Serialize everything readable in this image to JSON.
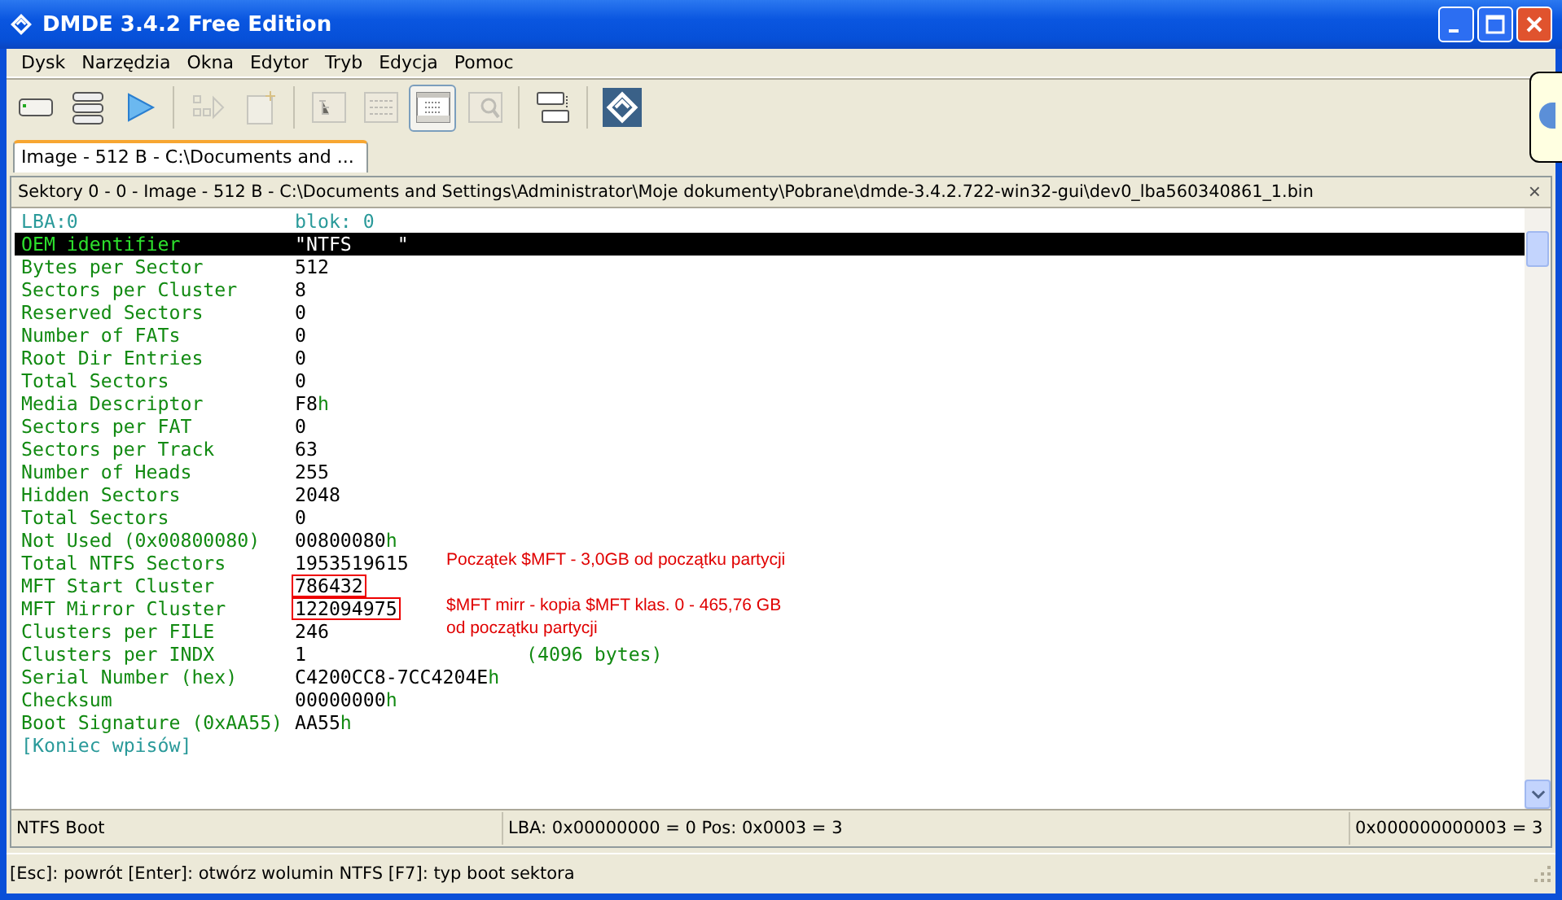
{
  "window": {
    "title": "DMDE 3.4.2 Free Edition"
  },
  "menu": [
    "Dysk",
    "Narzędzia",
    "Okna",
    "Edytor",
    "Tryb",
    "Edycja",
    "Pomoc"
  ],
  "toolbar": [
    {
      "kind": "drive",
      "disabled": false,
      "selected": false
    },
    {
      "kind": "partitions",
      "disabled": false,
      "selected": false
    },
    {
      "kind": "play",
      "disabled": false,
      "selected": false
    },
    {
      "kind": "sep"
    },
    {
      "kind": "blocks",
      "disabled": true,
      "selected": false
    },
    {
      "kind": "newfile",
      "disabled": true,
      "selected": false
    },
    {
      "kind": "sep"
    },
    {
      "kind": "tree",
      "disabled": true,
      "selected": false
    },
    {
      "kind": "list",
      "disabled": true,
      "selected": false
    },
    {
      "kind": "grid",
      "disabled": false,
      "selected": true
    },
    {
      "kind": "find",
      "disabled": true,
      "selected": false
    },
    {
      "kind": "sep"
    },
    {
      "kind": "panels",
      "disabled": false,
      "selected": false
    },
    {
      "kind": "sep"
    },
    {
      "kind": "logo",
      "disabled": false,
      "selected": false
    }
  ],
  "tabs": [
    {
      "label": "Image - 512 B - C:\\Documents and ...",
      "selected": true
    }
  ],
  "panel": {
    "title": "Sektory 0 - 0 - Image - 512 B - C:\\Documents and Settings\\Administrator\\Moje dokumenty\\Pobrane\\dmde-3.4.2.722-win32-gui\\dev0_lba560340861_1.bin",
    "close": "×",
    "header": {
      "label": "LBA:0",
      "value": "blok: 0"
    },
    "rows": [
      {
        "label": "OEM identifier",
        "value": "\"NTFS    \"",
        "selected": true
      },
      {
        "label": "Bytes per Sector",
        "value": "512",
        "selected": false
      },
      {
        "label": "Sectors per Cluster",
        "value": "8",
        "selected": false
      },
      {
        "label": "Reserved Sectors",
        "value": "0",
        "selected": false
      },
      {
        "label": "Number of FATs",
        "value": "0",
        "selected": false
      },
      {
        "label": "Root Dir Entries",
        "value": "0",
        "selected": false
      },
      {
        "label": "Total Sectors",
        "value": "0",
        "selected": false
      },
      {
        "label": "Media Descriptor",
        "value": "F8",
        "suffix": "h",
        "selected": false
      },
      {
        "label": "Sectors per FAT",
        "value": "0",
        "selected": false
      },
      {
        "label": "Sectors per Track",
        "value": "63",
        "selected": false
      },
      {
        "label": "Number of Heads",
        "value": "255",
        "selected": false
      },
      {
        "label": "Hidden Sectors",
        "value": "2048",
        "selected": false
      },
      {
        "label": "Total Sectors",
        "value": "0",
        "selected": false
      },
      {
        "label": "Not Used (0x00800080)",
        "value": "00800080",
        "suffix": "h",
        "selected": false
      },
      {
        "label": "Total NTFS Sectors",
        "value": "1953519615",
        "selected": false,
        "note": "Początek $MFT - 3,0GB od początku partycji"
      },
      {
        "label": "MFT Start Cluster",
        "value": "786432",
        "selected": false,
        "boxed": true
      },
      {
        "label": "MFT Mirror Cluster",
        "value": "122094975",
        "selected": false,
        "boxed": true,
        "note": "$MFT mirr - kopia $MFT klas. 0 - 465,76 GB\nod początku partycji"
      },
      {
        "label": "Clusters per FILE",
        "value": "246",
        "selected": false
      },
      {
        "label": "Clusters per INDX",
        "value": "1",
        "selected": false,
        "extra": "(4096 bytes)"
      },
      {
        "label": "Serial Number (hex)",
        "value": "C4200CC8-7CC4204E",
        "suffix": "h",
        "selected": false
      },
      {
        "label": "Checksum",
        "value": "00000000",
        "suffix": "h",
        "selected": false
      },
      {
        "label": "Boot Signature (0xAA55)",
        "value": "AA55",
        "suffix": "h",
        "selected": false
      }
    ],
    "footer": "[Koniec wpisów]",
    "status": [
      "NTFS Boot",
      "LBA: 0x00000000 = 0  Pos: 0x0003 = 3",
      "0x000000000003 = 3"
    ]
  },
  "status_bar": "[Esc]: powrót  [Enter]: otwórz wolumin NTFS  [F7]: typ boot sektora"
}
